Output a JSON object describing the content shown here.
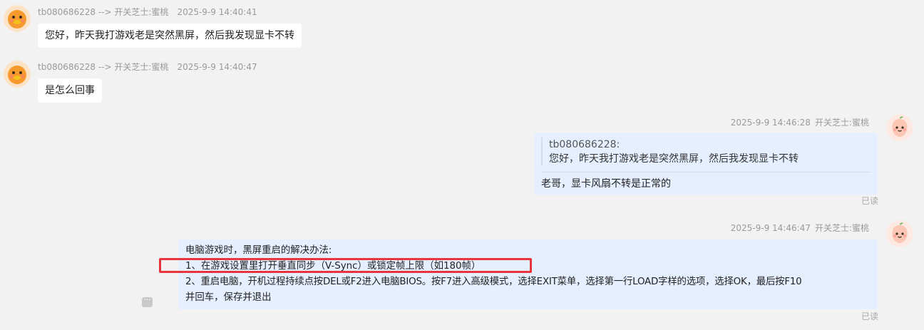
{
  "messages": [
    {
      "sender_line": "tb080686228 --> 开关芝士:蜜桃",
      "time": "2025-9-9 14:40:41",
      "text": "您好，昨天我打游戏老是突然黑屏，然后我发现显卡不转"
    },
    {
      "sender_line": "tb080686228 --> 开关芝士:蜜桃",
      "time": "2025-9-9 14:40:47",
      "text": "是怎么回事"
    },
    {
      "time": "2025-9-9 14:46:28",
      "sender": "开关芝士:蜜桃",
      "quote_author": "tb080686228:",
      "quote_text": "您好，昨天我打游戏老是突然黑屏，然后我发现显卡不转",
      "text": "老哥，显卡风扇不转是正常的",
      "status": "已读"
    },
    {
      "time": "2025-9-9 14:46:47",
      "sender": "开关芝士:蜜桃",
      "lines": [
        "电脑游戏时，黑屏重启的解决办法:",
        "1、在游戏设置里打开垂直同步（V-Sync）或锁定帧上限（如180帧）",
        "2、重启电脑，开机过程持续点按DEL或F2进入电脑BIOS。按F7进入高级模式，选择EXIT菜单，选择第一行LOAD字样的选项，选择OK，最后按F10",
        "并回车，保存并退出"
      ],
      "status": "已读",
      "more_icon": "ellipsis-icon"
    }
  ],
  "colors": {
    "background": "#f2f2f3",
    "incoming_bubble": "#ffffff",
    "outgoing_bubble": "#e6efff",
    "highlight": "#e8343c",
    "meta_text": "#9a9a9a"
  }
}
